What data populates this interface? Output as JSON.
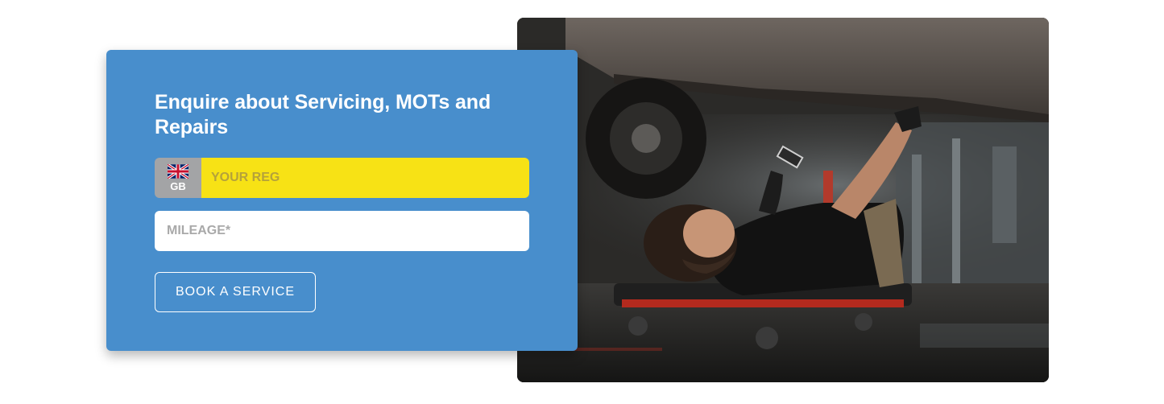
{
  "form": {
    "title": "Enquire about Servicing, MOTs and Repairs",
    "reg": {
      "country_code": "GB",
      "flag_icon": "uk-flag-icon",
      "placeholder": "YOUR REG"
    },
    "mileage": {
      "placeholder": "MILEAGE*"
    },
    "submit_label": "BOOK A SERVICE"
  },
  "photo": {
    "alt": "Mechanic lying on a creeper working underneath a car"
  },
  "colors": {
    "card_background": "#488ecc",
    "reg_plate_yellow": "#f7e215",
    "badge_grey": "#a3a4a6",
    "button_border": "#ffffff"
  }
}
